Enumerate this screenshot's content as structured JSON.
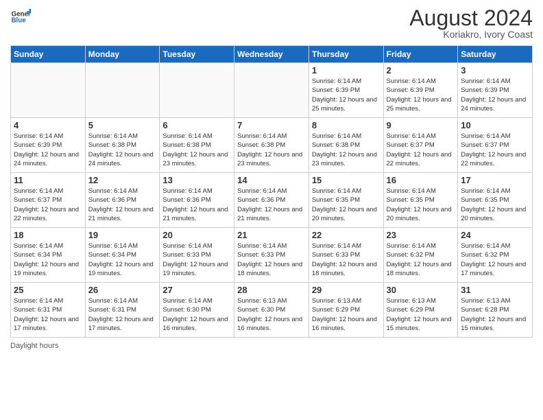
{
  "logo": {
    "line1": "General",
    "line2": "Blue"
  },
  "title": "August 2024",
  "location": "Koriakro, Ivory Coast",
  "days_of_week": [
    "Sunday",
    "Monday",
    "Tuesday",
    "Wednesday",
    "Thursday",
    "Friday",
    "Saturday"
  ],
  "footer_label": "Daylight hours",
  "weeks": [
    [
      {
        "day": "",
        "info": ""
      },
      {
        "day": "",
        "info": ""
      },
      {
        "day": "",
        "info": ""
      },
      {
        "day": "",
        "info": ""
      },
      {
        "day": "1",
        "info": "Sunrise: 6:14 AM\nSunset: 6:39 PM\nDaylight: 12 hours\nand 25 minutes."
      },
      {
        "day": "2",
        "info": "Sunrise: 6:14 AM\nSunset: 6:39 PM\nDaylight: 12 hours\nand 25 minutes."
      },
      {
        "day": "3",
        "info": "Sunrise: 6:14 AM\nSunset: 6:39 PM\nDaylight: 12 hours\nand 24 minutes."
      }
    ],
    [
      {
        "day": "4",
        "info": "Sunrise: 6:14 AM\nSunset: 6:39 PM\nDaylight: 12 hours\nand 24 minutes."
      },
      {
        "day": "5",
        "info": "Sunrise: 6:14 AM\nSunset: 6:38 PM\nDaylight: 12 hours\nand 24 minutes."
      },
      {
        "day": "6",
        "info": "Sunrise: 6:14 AM\nSunset: 6:38 PM\nDaylight: 12 hours\nand 23 minutes."
      },
      {
        "day": "7",
        "info": "Sunrise: 6:14 AM\nSunset: 6:38 PM\nDaylight: 12 hours\nand 23 minutes."
      },
      {
        "day": "8",
        "info": "Sunrise: 6:14 AM\nSunset: 6:38 PM\nDaylight: 12 hours\nand 23 minutes."
      },
      {
        "day": "9",
        "info": "Sunrise: 6:14 AM\nSunset: 6:37 PM\nDaylight: 12 hours\nand 22 minutes."
      },
      {
        "day": "10",
        "info": "Sunrise: 6:14 AM\nSunset: 6:37 PM\nDaylight: 12 hours\nand 22 minutes."
      }
    ],
    [
      {
        "day": "11",
        "info": "Sunrise: 6:14 AM\nSunset: 6:37 PM\nDaylight: 12 hours\nand 22 minutes."
      },
      {
        "day": "12",
        "info": "Sunrise: 6:14 AM\nSunset: 6:36 PM\nDaylight: 12 hours\nand 21 minutes."
      },
      {
        "day": "13",
        "info": "Sunrise: 6:14 AM\nSunset: 6:36 PM\nDaylight: 12 hours\nand 21 minutes."
      },
      {
        "day": "14",
        "info": "Sunrise: 6:14 AM\nSunset: 6:36 PM\nDaylight: 12 hours\nand 21 minutes."
      },
      {
        "day": "15",
        "info": "Sunrise: 6:14 AM\nSunset: 6:35 PM\nDaylight: 12 hours\nand 20 minutes."
      },
      {
        "day": "16",
        "info": "Sunrise: 6:14 AM\nSunset: 6:35 PM\nDaylight: 12 hours\nand 20 minutes."
      },
      {
        "day": "17",
        "info": "Sunrise: 6:14 AM\nSunset: 6:35 PM\nDaylight: 12 hours\nand 20 minutes."
      }
    ],
    [
      {
        "day": "18",
        "info": "Sunrise: 6:14 AM\nSunset: 6:34 PM\nDaylight: 12 hours\nand 19 minutes."
      },
      {
        "day": "19",
        "info": "Sunrise: 6:14 AM\nSunset: 6:34 PM\nDaylight: 12 hours\nand 19 minutes."
      },
      {
        "day": "20",
        "info": "Sunrise: 6:14 AM\nSunset: 6:33 PM\nDaylight: 12 hours\nand 19 minutes."
      },
      {
        "day": "21",
        "info": "Sunrise: 6:14 AM\nSunset: 6:33 PM\nDaylight: 12 hours\nand 18 minutes."
      },
      {
        "day": "22",
        "info": "Sunrise: 6:14 AM\nSunset: 6:33 PM\nDaylight: 12 hours\nand 18 minutes."
      },
      {
        "day": "23",
        "info": "Sunrise: 6:14 AM\nSunset: 6:32 PM\nDaylight: 12 hours\nand 18 minutes."
      },
      {
        "day": "24",
        "info": "Sunrise: 6:14 AM\nSunset: 6:32 PM\nDaylight: 12 hours\nand 17 minutes."
      }
    ],
    [
      {
        "day": "25",
        "info": "Sunrise: 6:14 AM\nSunset: 6:31 PM\nDaylight: 12 hours\nand 17 minutes."
      },
      {
        "day": "26",
        "info": "Sunrise: 6:14 AM\nSunset: 6:31 PM\nDaylight: 12 hours\nand 17 minutes."
      },
      {
        "day": "27",
        "info": "Sunrise: 6:14 AM\nSunset: 6:30 PM\nDaylight: 12 hours\nand 16 minutes."
      },
      {
        "day": "28",
        "info": "Sunrise: 6:13 AM\nSunset: 6:30 PM\nDaylight: 12 hours\nand 16 minutes."
      },
      {
        "day": "29",
        "info": "Sunrise: 6:13 AM\nSunset: 6:29 PM\nDaylight: 12 hours\nand 16 minutes."
      },
      {
        "day": "30",
        "info": "Sunrise: 6:13 AM\nSunset: 6:29 PM\nDaylight: 12 hours\nand 15 minutes."
      },
      {
        "day": "31",
        "info": "Sunrise: 6:13 AM\nSunset: 6:28 PM\nDaylight: 12 hours\nand 15 minutes."
      }
    ]
  ]
}
